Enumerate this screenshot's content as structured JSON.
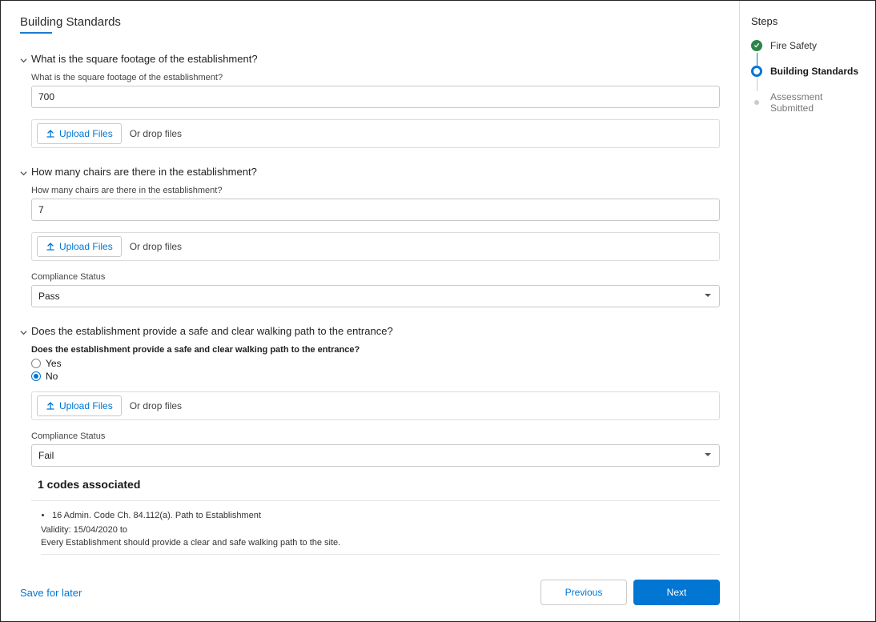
{
  "page_title": "Building Standards",
  "upload_button_label": "Upload Files",
  "drop_hint": "Or drop files",
  "compliance_label": "Compliance Status",
  "questions": {
    "q1": {
      "title": "What is the square footage of the establishment?",
      "field_label": "What is the square footage of the establishment?",
      "value": "700"
    },
    "q2": {
      "title": "How many chairs are there in the establishment?",
      "field_label": "How many chairs are there in the establishment?",
      "value": "7",
      "compliance_value": "Pass"
    },
    "q3": {
      "title": "Does the establishment provide a safe and clear walking path to the entrance?",
      "field_label": "Does the establishment provide a safe and clear walking path to the entrance?",
      "options": {
        "yes": "Yes",
        "no": "No"
      },
      "compliance_value": "Fail"
    }
  },
  "codes": {
    "heading": "1 codes associated",
    "items": [
      {
        "title": "16 Admin. Code Ch. 84.112(a). Path to Establishment",
        "validity": "Validity: 15/04/2020 to",
        "description": "Every Establishment should provide a clear and safe walking path to the site."
      }
    ]
  },
  "footer": {
    "save": "Save for later",
    "previous": "Previous",
    "next": "Next"
  },
  "sidebar": {
    "title": "Steps",
    "steps": [
      {
        "label": "Fire Safety",
        "state": "done"
      },
      {
        "label": "Building Standards",
        "state": "current"
      },
      {
        "label": "Assessment Submitted",
        "state": "upcoming"
      }
    ]
  }
}
